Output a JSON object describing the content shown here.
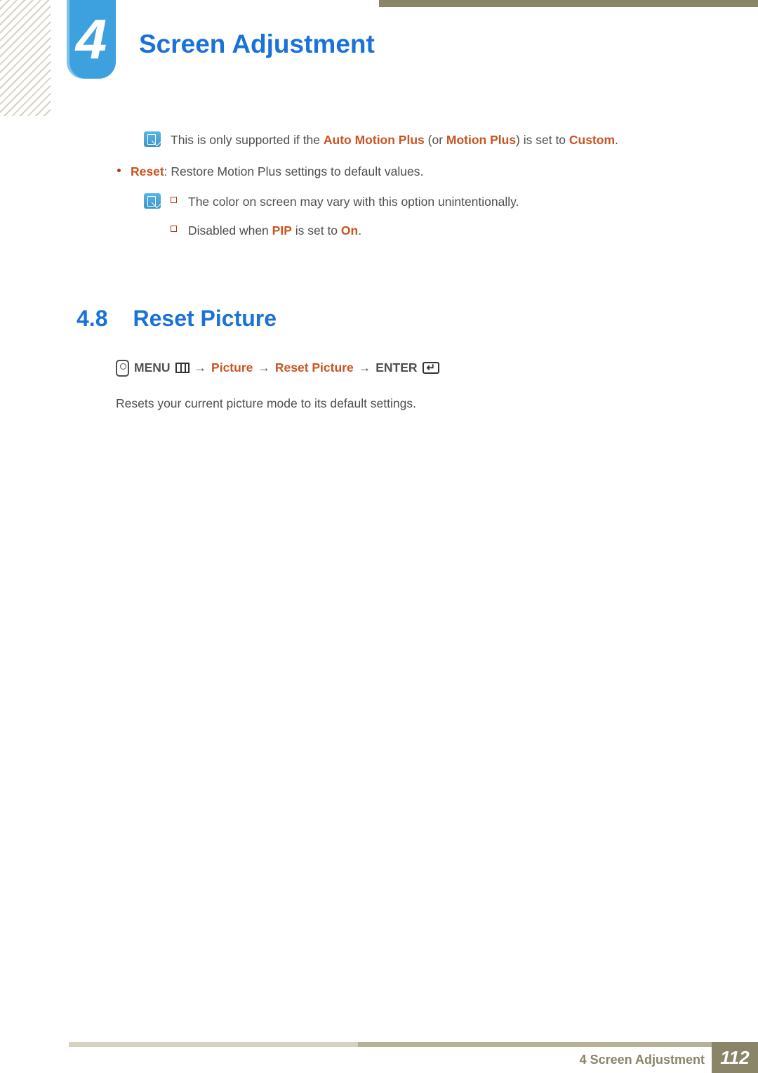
{
  "chapter": {
    "number": "4",
    "title": "Screen Adjustment"
  },
  "note1": {
    "prefix": "This is only supported if the ",
    "hl1": "Auto Motion Plus",
    "mid1": " (or ",
    "hl2": "Motion Plus",
    "mid2": ") is set to ",
    "hl3": "Custom",
    "suffix": "."
  },
  "bullet1": {
    "hl": "Reset",
    "text": ": Restore Motion Plus settings to default values."
  },
  "subnotes": {
    "a": "The color on screen may vary with this option unintentionally.",
    "b_prefix": "Disabled when ",
    "b_hl1": "PIP",
    "b_mid": " is set to ",
    "b_hl2": "On",
    "b_suffix": "."
  },
  "section": {
    "num": "4.8",
    "title": "Reset Picture"
  },
  "menupath": {
    "menu": "MENU",
    "p1": "Picture",
    "p2": "Reset Picture",
    "enter": "ENTER"
  },
  "arrow": "→",
  "para": "Resets your current picture mode to its default settings.",
  "footer": {
    "text": "4 Screen Adjustment",
    "page": "112"
  }
}
